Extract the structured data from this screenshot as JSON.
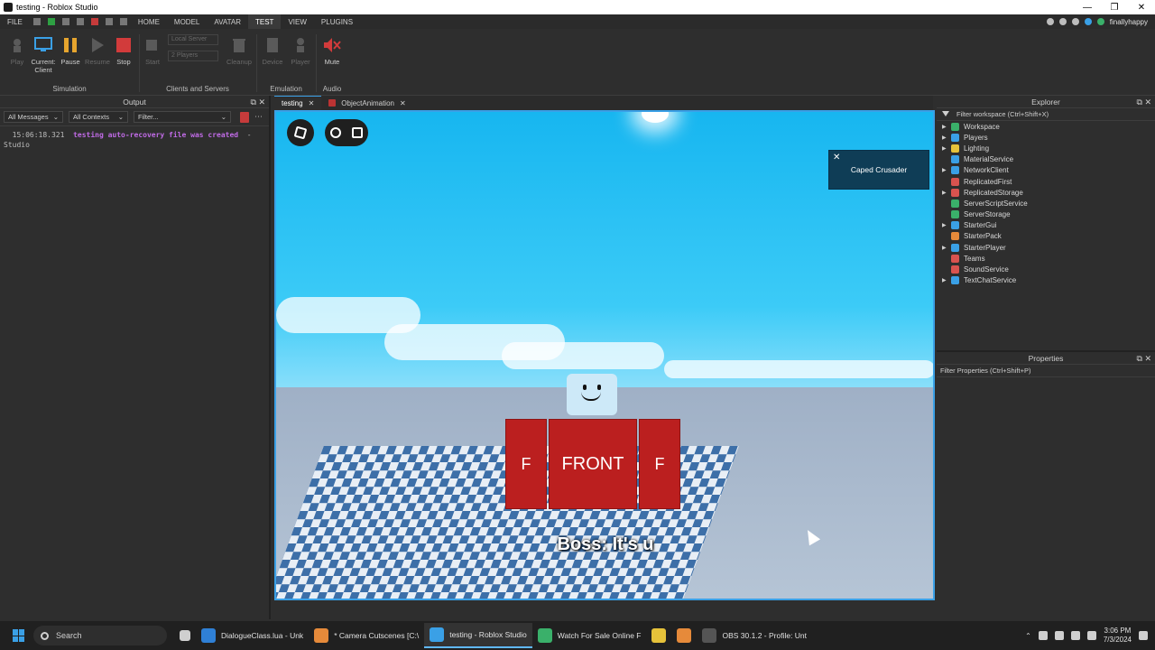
{
  "window": {
    "title": "testing - Roblox Studio"
  },
  "menu": {
    "items": [
      "FILE",
      "HOME",
      "MODEL",
      "AVATAR",
      "TEST",
      "VIEW",
      "PLUGINS"
    ],
    "active": "TEST",
    "user": "finallyhappy"
  },
  "ribbon": {
    "buttons": {
      "play": "Play",
      "current_client": "Current: Client",
      "pause": "Pause",
      "resume": "Resume",
      "stop": "Stop",
      "start": "Start",
      "cleanup": "Cleanup",
      "device": "Device",
      "player": "Player",
      "mute": "Mute"
    },
    "server_select": "Local Server",
    "players_select": "2 Players",
    "groups": {
      "simulation": "Simulation",
      "clients_servers": "Clients and Servers",
      "emulation": "Emulation",
      "audio": "Audio"
    }
  },
  "output": {
    "title": "Output",
    "messages_filter": "All Messages",
    "contexts_filter": "All Contexts",
    "filter_placeholder": "Filter...",
    "log": [
      {
        "time": "15:06:18.321",
        "message": "testing auto-recovery file was created",
        "source": "Studio"
      }
    ]
  },
  "doc_tabs": [
    {
      "label": "testing",
      "active": true
    },
    {
      "label": "ObjectAnimation",
      "active": false
    }
  ],
  "viewport": {
    "notification": "Caped Crusader",
    "torso_text": "FRONT",
    "arm_text": "F",
    "subtitle": "Boss: It's u"
  },
  "explorer": {
    "title": "Explorer",
    "filter": "Filter workspace (Ctrl+Shift+X)",
    "items": [
      {
        "label": "Workspace",
        "color": "#3ab06a",
        "expandable": true
      },
      {
        "label": "Players",
        "color": "#3aa0e6",
        "expandable": true
      },
      {
        "label": "Lighting",
        "color": "#e6c23a",
        "expandable": true
      },
      {
        "label": "MaterialService",
        "color": "#3aa0e6",
        "expandable": false
      },
      {
        "label": "NetworkClient",
        "color": "#3aa0e6",
        "expandable": true
      },
      {
        "label": "ReplicatedFirst",
        "color": "#d9534f",
        "expandable": false
      },
      {
        "label": "ReplicatedStorage",
        "color": "#d9534f",
        "expandable": true
      },
      {
        "label": "ServerScriptService",
        "color": "#3ab06a",
        "expandable": false
      },
      {
        "label": "ServerStorage",
        "color": "#3ab06a",
        "expandable": false
      },
      {
        "label": "StarterGui",
        "color": "#3aa0e6",
        "expandable": true
      },
      {
        "label": "StarterPack",
        "color": "#e68a3a",
        "expandable": false
      },
      {
        "label": "StarterPlayer",
        "color": "#3aa0e6",
        "expandable": true
      },
      {
        "label": "Teams",
        "color": "#d9534f",
        "expandable": false
      },
      {
        "label": "SoundService",
        "color": "#d9534f",
        "expandable": false
      },
      {
        "label": "TextChatService",
        "color": "#3aa0e6",
        "expandable": true
      }
    ]
  },
  "properties": {
    "title": "Properties",
    "filter": "Filter Properties (Ctrl+Shift+P)"
  },
  "taskbar": {
    "search": "Search",
    "items": [
      {
        "label": "DialogueClass.lua - Unk",
        "color": "#2f80d6",
        "active": false
      },
      {
        "label": "* Camera Cutscenes [C:\\",
        "color": "#e68a3a",
        "active": false
      },
      {
        "label": "testing - Roblox Studio",
        "color": "#3aa0e6",
        "active": true
      },
      {
        "label": "Watch For Sale Online F",
        "color": "#3ab06a",
        "active": false
      },
      {
        "label": "",
        "color": "#e6c23a",
        "active": false
      },
      {
        "label": "",
        "color": "#e68a3a",
        "active": false
      },
      {
        "label": "OBS 30.1.2 - Profile: Unt",
        "color": "#555555",
        "active": false
      }
    ],
    "time": "3:06 PM",
    "date": "7/3/2024"
  }
}
